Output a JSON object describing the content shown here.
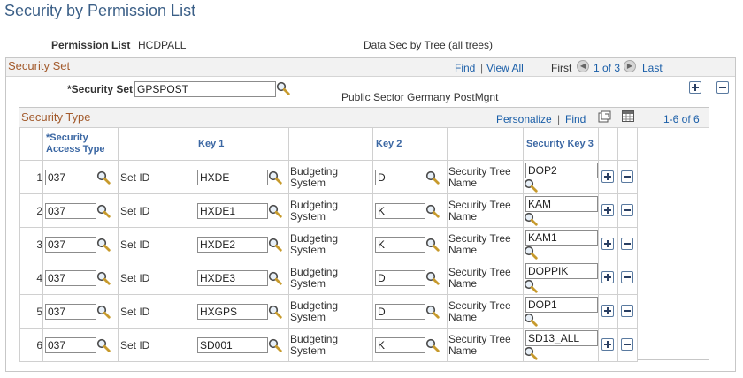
{
  "page_title": "Security by Permission List",
  "permission_list": {
    "label": "Permission List",
    "value": "HCDPALL"
  },
  "data_sec_text": "Data Sec by Tree (all trees)",
  "security_set": {
    "title": "Security Set",
    "nav": {
      "find": "Find",
      "sep": "|",
      "view_all": "View All",
      "first": "First",
      "range": "1 of 3",
      "last": "Last"
    },
    "field_label": "*Security Set",
    "field_value": "GPSPOST",
    "description": "Public Sector Germany PostMgnt"
  },
  "security_type": {
    "title": "Security Type",
    "nav": {
      "personalize": "Personalize",
      "sep": "|",
      "find": "Find",
      "range": "1-6 of 6"
    },
    "columns": {
      "access_type_line1": "*Security",
      "access_type_line2": "Access Type",
      "key1": "Key 1",
      "key2": "Key 2",
      "security_key3": "Security Key 3"
    },
    "rows": [
      {
        "num": "1",
        "access_type": "037",
        "key1_label": "Set ID",
        "key1": "HXDE",
        "key2_label_a": "Budgeting",
        "key2_label_b": "System",
        "key2": "D",
        "key3_label_a": "Security Tree",
        "key3_label_b": "Name",
        "key3": "DOP2"
      },
      {
        "num": "2",
        "access_type": "037",
        "key1_label": "Set ID",
        "key1": "HXDE1",
        "key2_label_a": "Budgeting",
        "key2_label_b": "System",
        "key2": "K",
        "key3_label_a": "Security Tree",
        "key3_label_b": "Name",
        "key3": "KAM"
      },
      {
        "num": "3",
        "access_type": "037",
        "key1_label": "Set ID",
        "key1": "HXDE2",
        "key2_label_a": "Budgeting",
        "key2_label_b": "System",
        "key2": "K",
        "key3_label_a": "Security Tree",
        "key3_label_b": "Name",
        "key3": "KAM1"
      },
      {
        "num": "4",
        "access_type": "037",
        "key1_label": "Set ID",
        "key1": "HXDE3",
        "key2_label_a": "Budgeting",
        "key2_label_b": "System",
        "key2": "D",
        "key3_label_a": "Security Tree",
        "key3_label_b": "Name",
        "key3": "DOPPIK"
      },
      {
        "num": "5",
        "access_type": "037",
        "key1_label": "Set ID",
        "key1": "HXGPS",
        "key2_label_a": "Budgeting",
        "key2_label_b": "System",
        "key2": "D",
        "key3_label_a": "Security Tree",
        "key3_label_b": "Name",
        "key3": "DOP1"
      },
      {
        "num": "6",
        "access_type": "037",
        "key1_label": "Set ID",
        "key1": "SD001",
        "key2_label_a": "Budgeting",
        "key2_label_b": "System",
        "key2": "K",
        "key3_label_a": "Security Tree",
        "key3_label_b": "Name",
        "key3": "SD13_ALL"
      }
    ]
  },
  "colors": {
    "title": "#3b5f87",
    "group_title": "#a35b2d",
    "link": "#1a5ea8",
    "header_text": "#3b67a3"
  }
}
